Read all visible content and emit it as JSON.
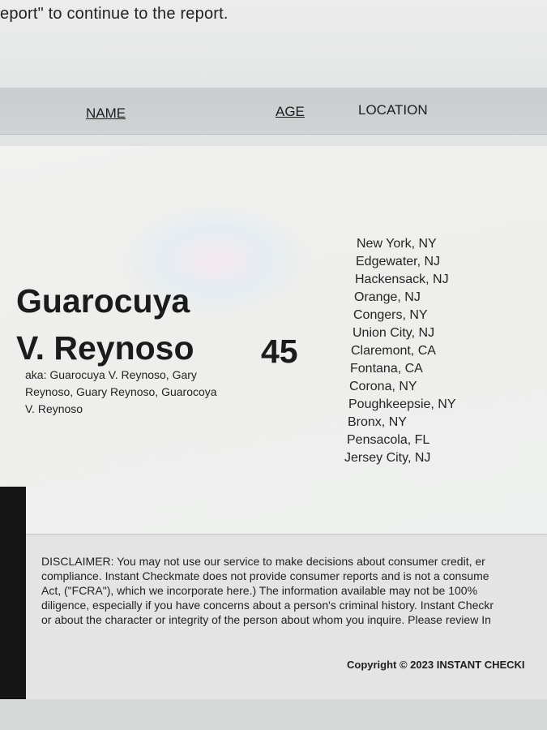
{
  "page": {
    "top_text": "eport\" to continue to the report."
  },
  "table": {
    "columns": {
      "name": "NAME",
      "age": "AGE",
      "location": "LOCATION"
    }
  },
  "result": {
    "name_line1": "Guarocuya",
    "name_line2": "V. Reynoso",
    "aka": "aka: Guarocuya V. Reynoso, Gary Reynoso, Guary Reynoso, Guarocoya V. Reynoso",
    "age": "45",
    "locations": [
      "New York, NY",
      "Edgewater, NJ",
      "Hackensack, NJ",
      "Orange, NJ",
      "Congers, NY",
      "Union City, NJ",
      "Claremont, CA",
      "Fontana, CA",
      "Corona, NY",
      "Poughkeepsie, NY",
      "Bronx, NY",
      "Pensacola, FL",
      "Jersey City, NJ"
    ]
  },
  "footer": {
    "disclaimer_lines": [
      "DISCLAIMER: You may not use our service to make decisions about consumer credit, er",
      "compliance. Instant Checkmate does not provide consumer reports and is not a consume",
      "Act, (\"FCRA\"), which we incorporate here.) The information available may not be 100%",
      "diligence, especially if you have concerns about a person's criminal history. Instant Checkr",
      "or about the character or integrity of the person about whom you inquire. Please review In"
    ],
    "copyright": "Copyright © 2023 INSTANT CHECKI"
  }
}
